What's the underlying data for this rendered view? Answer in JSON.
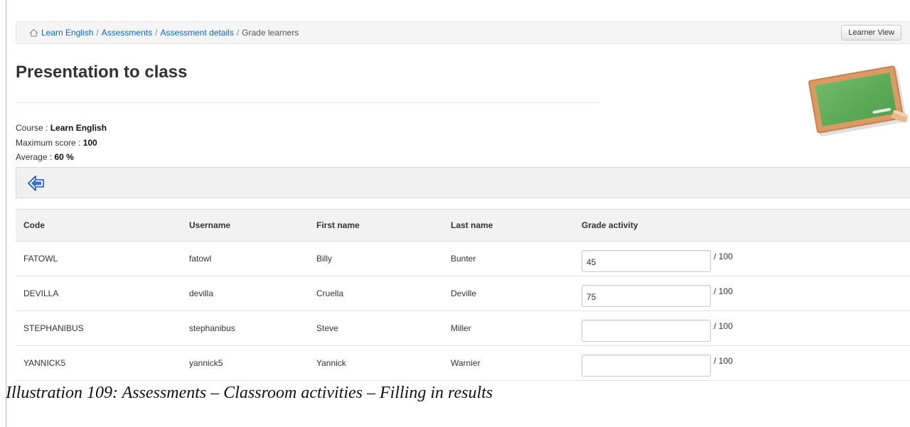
{
  "breadcrumb": {
    "items": [
      "Learn English",
      "Assessments",
      "Assessment details"
    ],
    "separator": "/",
    "current": "Grade learners"
  },
  "header": {
    "learner_view_label": "Learner View"
  },
  "page": {
    "title": "Presentation to class"
  },
  "info": {
    "course_label": "Course : ",
    "course_value": "Learn English",
    "max_score_label": "Maximum score : ",
    "max_score_value": "100",
    "average_label": "Average : ",
    "average_value": "60 %"
  },
  "table": {
    "headers": [
      "Code",
      "Username",
      "First name",
      "Last name",
      "Grade activity"
    ],
    "max_suffix": "/ 100",
    "rows": [
      {
        "code": "FATOWL",
        "username": "fatowl",
        "first_name": "Billy",
        "last_name": "Bunter",
        "grade": "45"
      },
      {
        "code": "DEVILLA",
        "username": "devilla",
        "first_name": "Cruella",
        "last_name": "Deville",
        "grade": "75"
      },
      {
        "code": "STEPHANIBUS",
        "username": "stephanibus",
        "first_name": "Steve",
        "last_name": "Miller",
        "grade": ""
      },
      {
        "code": "YANNICK5",
        "username": "yannick5",
        "first_name": "Yannick",
        "last_name": "Warnier",
        "grade": ""
      }
    ]
  },
  "caption": "Illustration 109: Assessments – Classroom activities – Filling in results",
  "icons": {
    "home": "home-icon",
    "back": "back-arrow-icon",
    "chalkboard": "chalkboard-icon"
  },
  "colors": {
    "link": "#0a66c2",
    "chalkboard_green": "#5fae5a",
    "chalkboard_frame": "#c9824f",
    "back_arrow": "#2e6fd8"
  }
}
